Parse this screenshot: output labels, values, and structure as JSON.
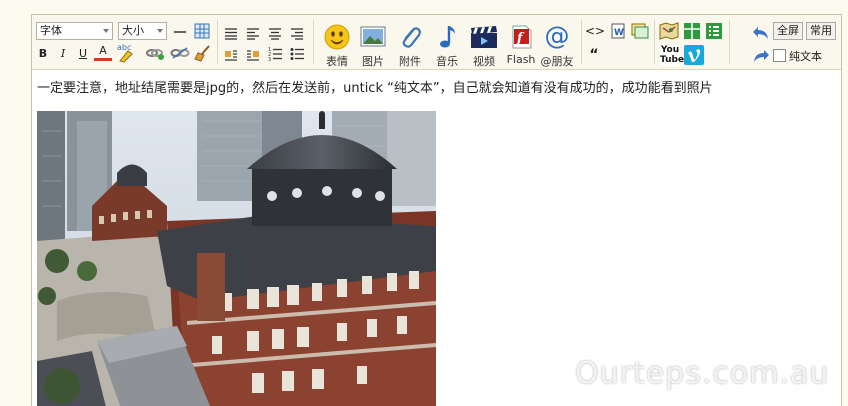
{
  "toolbar": {
    "font_select": "字体",
    "size_select": "大小",
    "bold": "B",
    "italic": "I",
    "underline": "U",
    "font_color": "A",
    "spell": "abc",
    "source_code": "<>",
    "quote": "“",
    "emoticon_label": "表情",
    "image_label": "图片",
    "attachment_label": "附件",
    "music_label": "音乐",
    "video_label": "视频",
    "flash_label": "Flash",
    "friends_label": "@朋友",
    "friends_symbol": "@",
    "youtube": "You Tube",
    "fullscreen_label": "全屏",
    "common_label": "常用",
    "plaintext_label": "纯文本"
  },
  "content": {
    "text": "一定要注意，地址结尾需要是jpg的，然后在发送前，untick “纯文本”，自己就会知道有没有成功的，成功能看到照片"
  },
  "watermark": "Ourteps.com.au"
}
